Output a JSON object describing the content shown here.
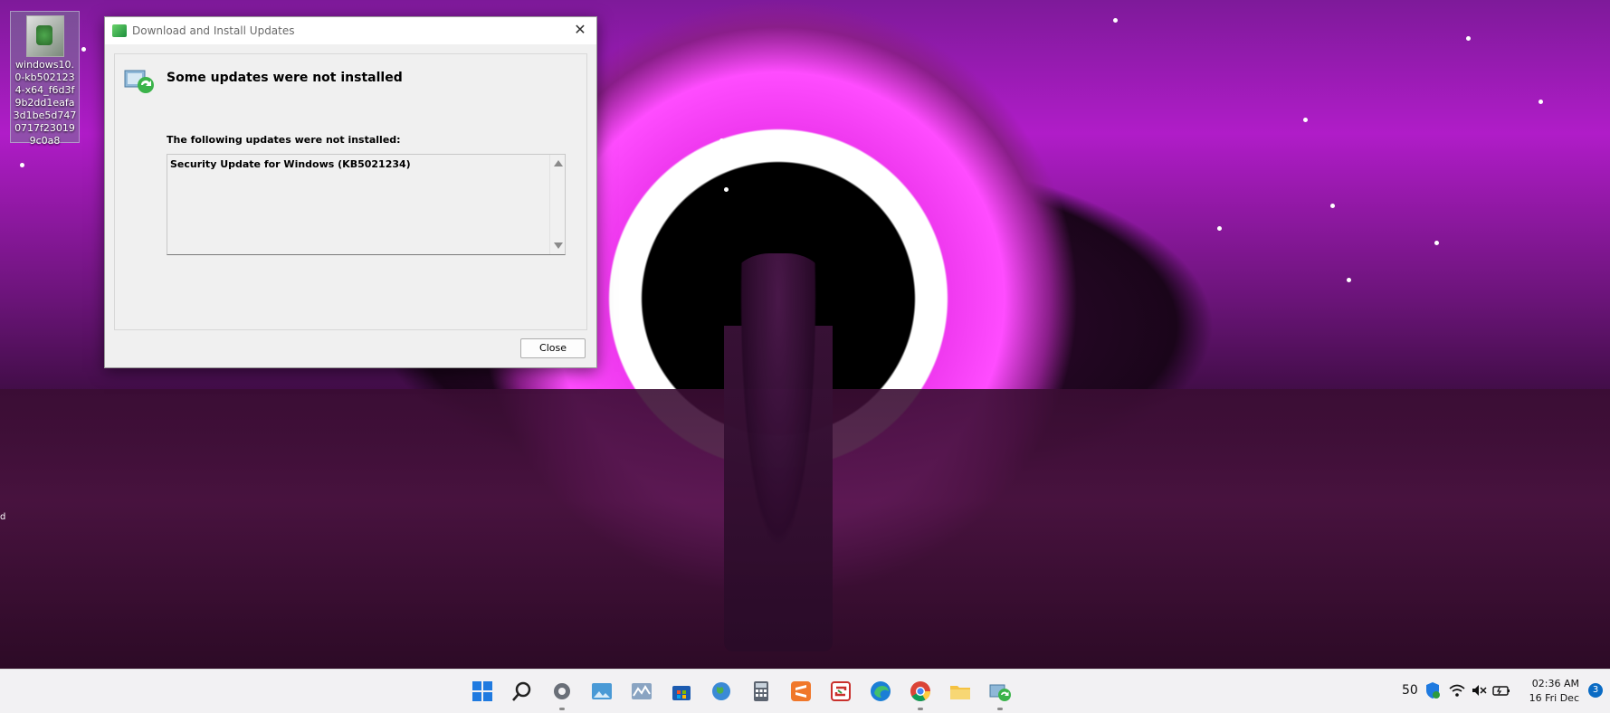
{
  "desktop": {
    "icon_label": "windows10.0-kb5021234-x64_f6d3f9b2dd1eafa3d1be5d7470717f230199c0a8",
    "left_edge_text": "d"
  },
  "dialog": {
    "title": "Download and Install Updates",
    "heading": "Some updates were not installed",
    "sublabel": "The following updates were not installed:",
    "updates": [
      "Security Update for Windows (KB5021234)"
    ],
    "close_label": "Close",
    "close_glyph": "✕"
  },
  "taskbar": {
    "apps": [
      "start-icon",
      "search-icon",
      "settings-icon",
      "photos-icon",
      "activity-monitor-icon",
      "store-icon",
      "network-globe-icon",
      "calculator-icon",
      "sublime-icon",
      "sync-app-icon",
      "edge-icon",
      "chrome-icon",
      "file-explorer-icon",
      "windows-update-icon"
    ],
    "tray": {
      "number": "50",
      "time": "02:36 AM",
      "date": "16 Fri Dec",
      "notifications": "3"
    }
  }
}
